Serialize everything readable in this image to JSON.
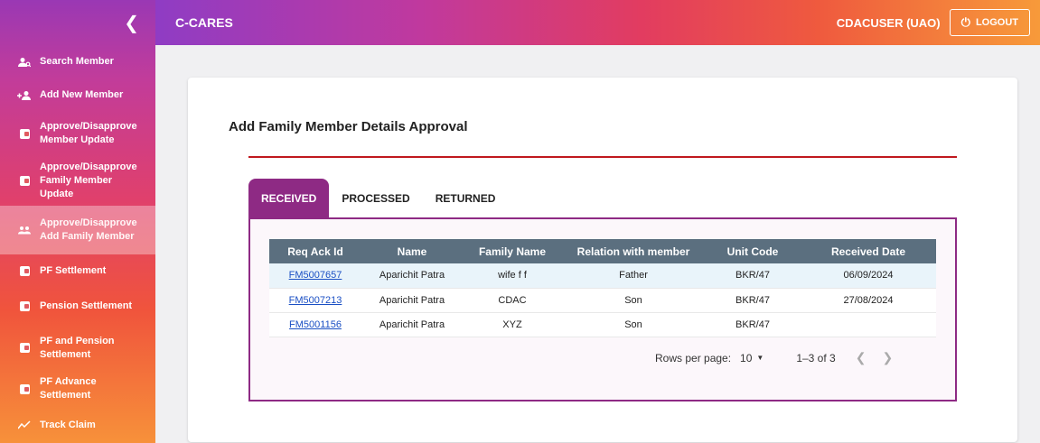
{
  "header": {
    "brand": "C-CARES",
    "user": "CDACUSER (UAO)",
    "logout_label": "LOGOUT"
  },
  "sidebar": {
    "items": [
      {
        "label": "Search Member",
        "icon": "person-search-icon"
      },
      {
        "label": "Add New Member",
        "icon": "person-add-icon"
      },
      {
        "label": "Approve/Disapprove Member Update",
        "icon": "wallet-icon"
      },
      {
        "label": "Approve/Disapprove Family Member Update",
        "icon": "wallet-icon"
      },
      {
        "label": "Approve/Disapprove Add Family Member",
        "icon": "group-icon"
      },
      {
        "label": "PF Settlement",
        "icon": "wallet-icon"
      },
      {
        "label": "Pension Settlement",
        "icon": "wallet-icon"
      },
      {
        "label": "PF and Pension Settlement",
        "icon": "wallet-icon"
      },
      {
        "label": "PF Advance Settlement",
        "icon": "wallet-icon"
      },
      {
        "label": "Track Claim",
        "icon": "trend-icon"
      }
    ]
  },
  "card": {
    "title": "Add Family Member Details Approval"
  },
  "tabs": [
    {
      "label": "RECEIVED"
    },
    {
      "label": "PROCESSED"
    },
    {
      "label": "RETURNED"
    }
  ],
  "table": {
    "headers": [
      "Req Ack Id",
      "Name",
      "Family Name",
      "Relation with member",
      "Unit Code",
      "Received Date"
    ],
    "rows": [
      [
        "FM5007657",
        "Aparichit Patra",
        "wife f f",
        "Father",
        "BKR/47",
        "06/09/2024"
      ],
      [
        "FM5007213",
        "Aparichit Patra",
        "CDAC",
        "Son",
        "BKR/47",
        "27/08/2024"
      ],
      [
        "FM5001156",
        "Aparichit Patra",
        "XYZ",
        "Son",
        "BKR/47",
        ""
      ]
    ]
  },
  "pager": {
    "rows_label": "Rows per page:",
    "rows_value": "10",
    "range": "1–3 of 3"
  },
  "colors": {
    "accent": "#8e2a84",
    "header_row": "#5b6f7f",
    "divider": "#c0181e",
    "link": "#1a4fc4"
  }
}
